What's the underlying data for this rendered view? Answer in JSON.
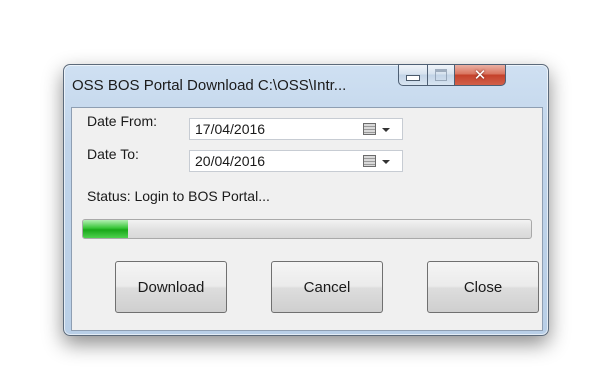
{
  "window": {
    "title": "OSS BOS Portal Download C:\\OSS\\Intr..."
  },
  "form": {
    "date_from_label": "Date From:",
    "date_from_value": "17/04/2016",
    "date_to_label": "Date To:",
    "date_to_value": "20/04/2016",
    "status_text": "Status: Login to BOS Portal..."
  },
  "progress": {
    "fraction": 0.1
  },
  "buttons": {
    "download": "Download",
    "cancel": "Cancel",
    "close": "Close"
  },
  "icons": {
    "minimize": "minimize-icon",
    "maximize": "maximize-icon",
    "close": "close-icon",
    "calendar": "calendar-icon",
    "dropdown": "chevron-down-icon"
  },
  "colors": {
    "progress_fill": "#22b422",
    "close_button": "#c4412b"
  }
}
